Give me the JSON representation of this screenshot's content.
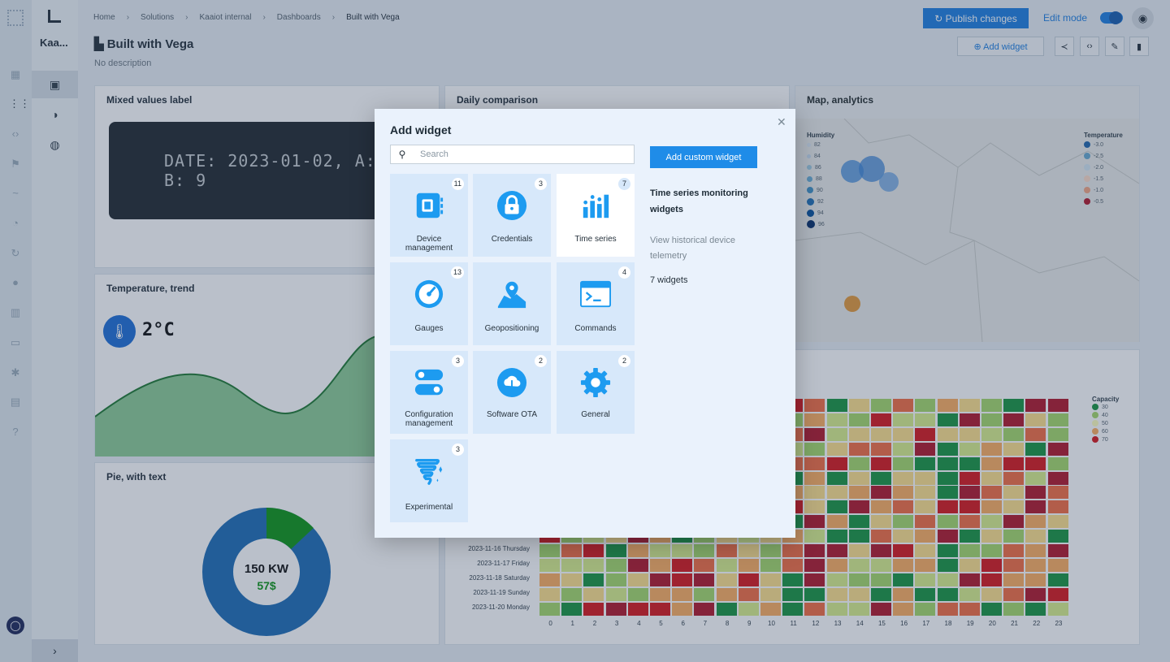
{
  "app": {
    "org": "Kaa..."
  },
  "breadcrumb": [
    "Home",
    "Solutions",
    "Kaaiot internal",
    "Dashboards",
    "Built with Vega"
  ],
  "header": {
    "publish_label": "Publish changes",
    "edit_mode_label": "Edit mode",
    "edit_mode_on": true
  },
  "dashboard": {
    "title": "Built with Vega",
    "description": "No description",
    "add_widget_label": "Add widget"
  },
  "widgets": {
    "mixed": {
      "title": "Mixed values label",
      "display": "DATE: 2023-01-02, A: 14, B: 9"
    },
    "daily": {
      "title": "Daily comparison"
    },
    "map": {
      "title": "Map, analytics",
      "humidity_title": "Humidity",
      "humidity_values": [
        "82",
        "84",
        "86",
        "88",
        "90",
        "92",
        "94",
        "96"
      ],
      "temperature_title": "Temperature",
      "temperature_values": [
        "-3.0",
        "-2.5",
        "-2.0",
        "-1.5",
        "-1.0",
        "-0.5"
      ]
    },
    "temp": {
      "title": "Temperature, trend",
      "value": "2°C"
    },
    "pie": {
      "title": "Pie, with text",
      "value": "150 KW",
      "price": "57$"
    },
    "heatmap": {
      "legend_title": "Capacity",
      "legend_values": [
        "30",
        "40",
        "50",
        "60",
        "70"
      ],
      "row_labels": [
        "2023-11-16 Thursday",
        "2023-11-17 Friday",
        "2023-11-18 Saturday",
        "2023-11-19 Sunday",
        "2023-11-20 Monday"
      ],
      "x_labels": [
        "0",
        "1",
        "2",
        "3",
        "4",
        "5",
        "6",
        "7",
        "8",
        "9",
        "10",
        "11",
        "12",
        "13",
        "14",
        "15",
        "16",
        "17",
        "18",
        "19",
        "20",
        "21",
        "22",
        "23"
      ]
    }
  },
  "modal": {
    "title": "Add widget",
    "search_placeholder": "Search",
    "add_custom_label": "Add custom widget",
    "categories": [
      {
        "label": "Device management",
        "count": "11",
        "icon": "device-management-icon"
      },
      {
        "label": "Credentials",
        "count": "3",
        "icon": "lock-icon"
      },
      {
        "label": "Time series",
        "count": "7",
        "icon": "bar-chart-icon",
        "selected": true
      },
      {
        "label": "Gauges",
        "count": "13",
        "icon": "gauge-icon"
      },
      {
        "label": "Geopositioning",
        "count": "",
        "icon": "map-pin-icon"
      },
      {
        "label": "Commands",
        "count": "4",
        "icon": "terminal-icon"
      },
      {
        "label": "Configuration management",
        "count": "3",
        "icon": "toggles-icon"
      },
      {
        "label": "Software OTA",
        "count": "2",
        "icon": "cloud-download-icon"
      },
      {
        "label": "General",
        "count": "2",
        "icon": "gear-icon"
      },
      {
        "label": "Experimental",
        "count": "3",
        "icon": "tornado-sparkle-icon"
      }
    ],
    "selected_title": "Time series monitoring widgets",
    "selected_description": "View historical device telemetry",
    "selected_count": "7 widgets"
  },
  "colors": {
    "accent": "#1f8ce8",
    "tile": "#d7e8fa",
    "modal_bg": "#eaf2fc"
  }
}
